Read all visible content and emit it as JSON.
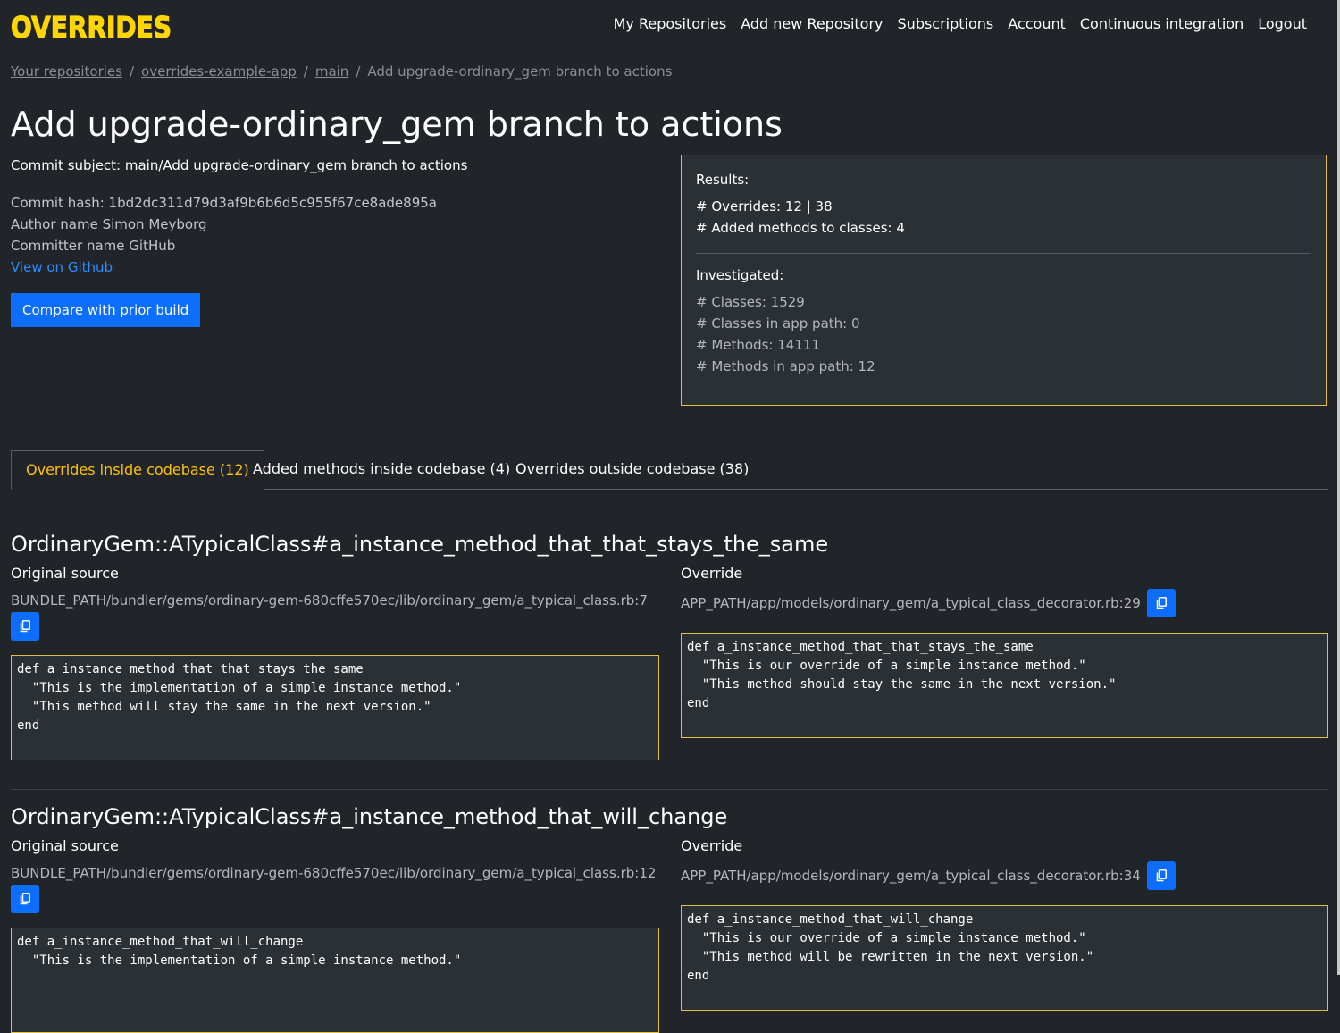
{
  "brand": {
    "name": "OVERRIDES",
    "color": "#ffd600"
  },
  "nav": [
    "My Repositories",
    "Add new Repository",
    "Subscriptions",
    "Account",
    "Continuous integration",
    "Logout"
  ],
  "breadcrumb": {
    "items": [
      "Your repositories",
      "overrides-example-app",
      "main"
    ],
    "current": "Add upgrade-ordinary_gem branch to actions",
    "separator": "/"
  },
  "page_title": "Add upgrade-ordinary_gem branch to actions",
  "commit": {
    "subject": "Commit subject: main/Add upgrade-ordinary_gem branch to actions",
    "hash": "Commit hash: 1bd2dc311d79d3af9b6b6d5c955f67ce8ade895a",
    "author": "Author name Simon Meyborg",
    "committer": "Committer name GitHub",
    "github_link": "View on Github",
    "compare_button": "Compare with prior build"
  },
  "results": {
    "heading": "Results:",
    "overrides": "# Overrides: 12 | 38",
    "added_methods": "# Added methods to classes: 4",
    "investigated_heading": "Investigated:",
    "classes": "# Classes: 1529",
    "classes_in_app": "# Classes in app path: 0",
    "methods": "# Methods: 14111",
    "methods_in_app": "# Methods in app path: 12"
  },
  "tabs": [
    {
      "label": "Overrides inside codebase (12)",
      "active": true
    },
    {
      "label": "Added methods inside codebase (4)",
      "active": false
    },
    {
      "label": "Overrides outside codebase (38)",
      "active": false
    }
  ],
  "overrides": [
    {
      "method": "OrdinaryGem::ATypicalClass#a_instance_method_that_that_stays_the_same",
      "original_label": "Original source",
      "original_path": "BUNDLE_PATH/bundler/gems/ordinary-gem-680cffe570ec/lib/ordinary_gem/a_typical_class.rb:7",
      "original_code": "def a_instance_method_that_that_stays_the_same\n  \"This is the implementation of a simple instance method.\"\n  \"This method will stay the same in the next version.\"\nend",
      "override_label": "Override",
      "override_path": "APP_PATH/app/models/ordinary_gem/a_typical_class_decorator.rb:29",
      "override_code": "def a_instance_method_that_that_stays_the_same\n  \"This is our override of a simple instance method.\"\n  \"This method should stay the same in the next version.\"\nend"
    },
    {
      "method": "OrdinaryGem::ATypicalClass#a_instance_method_that_will_change",
      "original_label": "Original source",
      "original_path": "BUNDLE_PATH/bundler/gems/ordinary-gem-680cffe570ec/lib/ordinary_gem/a_typical_class.rb:12",
      "original_code": "def a_instance_method_that_will_change\n  \"This is the implementation of a simple instance method.\"",
      "override_label": "Override",
      "override_path": "APP_PATH/app/models/ordinary_gem/a_typical_class_decorator.rb:34",
      "override_code": "def a_instance_method_that_will_change\n  \"This is our override of a simple instance method.\"\n  \"This method will be rewritten in the next version.\"\nend"
    }
  ]
}
